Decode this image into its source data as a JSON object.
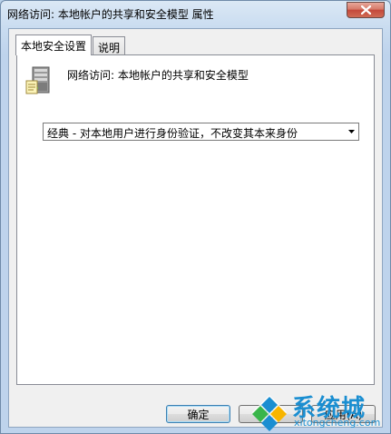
{
  "window": {
    "title": "网络访问: 本地帐户的共享和安全模型 属性"
  },
  "tabs": [
    {
      "label": "本地安全设置",
      "active": true
    },
    {
      "label": "说明",
      "active": false
    }
  ],
  "policy": {
    "name": "网络访问: 本地帐户的共享和安全模型",
    "icon": "server-computer-icon"
  },
  "dropdown": {
    "selected": "经典 - 对本地用户进行身份验证，不改变其本来身份"
  },
  "buttons": {
    "ok": "确定",
    "cancel": "取消",
    "apply": "应用(A)"
  },
  "watermark": {
    "text_cn": "系统城",
    "text_en": "xitongcheng.com"
  },
  "colors": {
    "accent": "#1a8ed1",
    "close_button": "#c4483a"
  }
}
